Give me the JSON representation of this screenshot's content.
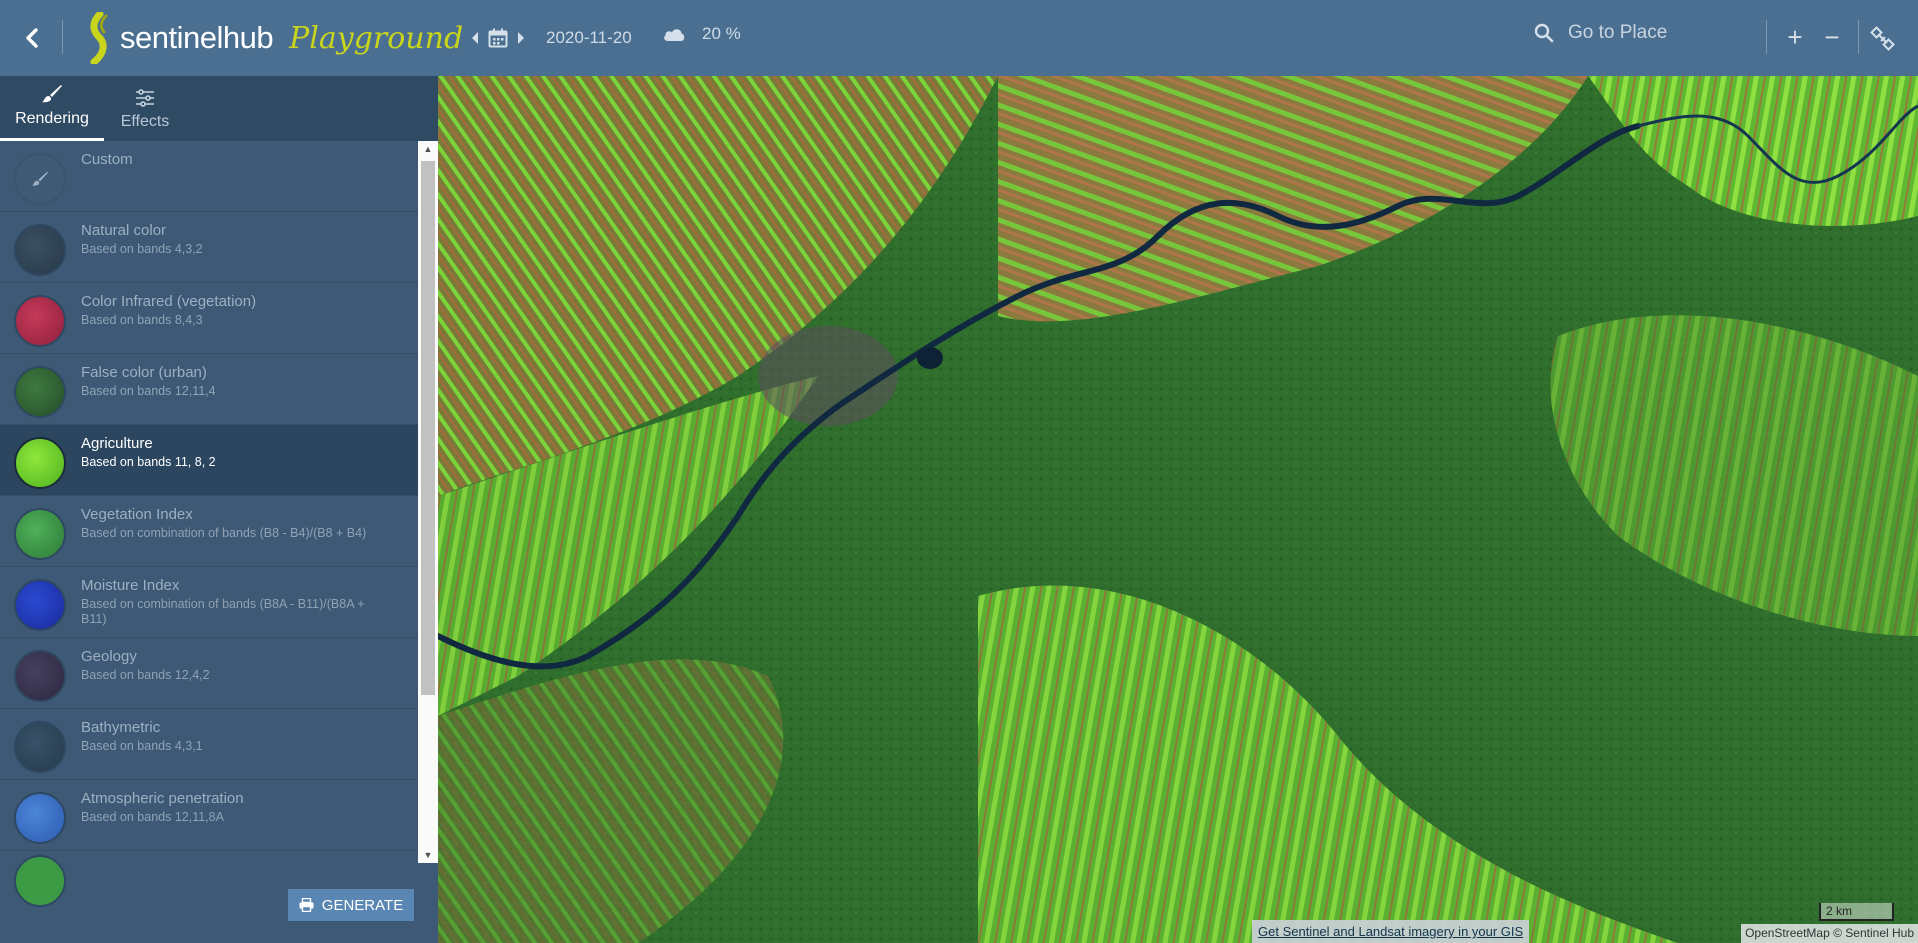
{
  "app": {
    "brand": "sentinelhub",
    "product": "Playground"
  },
  "header": {
    "date": "2020-11-20",
    "cloud_coverage": "20 %",
    "search_placeholder": "Go to Place",
    "zoom_in": "+",
    "zoom_out": "−"
  },
  "sidebar": {
    "tabs": [
      {
        "label": "Rendering",
        "icon": "brush-icon",
        "active": true
      },
      {
        "label": "Effects",
        "icon": "sliders-icon",
        "active": false
      }
    ],
    "items": [
      {
        "title": "Custom",
        "desc": "",
        "thumb_color": "#3f5a74",
        "active": false
      },
      {
        "title": "Natural color",
        "desc": "Based on bands 4,3,2",
        "thumb_color": "#2f4352",
        "active": false
      },
      {
        "title": "Color Infrared (vegetation)",
        "desc": "Based on bands 8,4,3",
        "thumb_color": "#b02848",
        "active": false
      },
      {
        "title": "False color (urban)",
        "desc": "Based on bands 12,11,4",
        "thumb_color": "#2f6135",
        "active": false
      },
      {
        "title": "Agriculture",
        "desc": "Based on bands 11, 8, 2",
        "thumb_color": "#6fd32a",
        "active": true
      },
      {
        "title": "Vegetation Index",
        "desc": "Based on combination of bands (B8 - B4)/(B8 + B4)",
        "thumb_color": "#3c9a45",
        "active": false
      },
      {
        "title": "Moisture Index",
        "desc": "Based on combination of bands (B8A - B11)/(B8A + B11)",
        "thumb_color": "#1e37b8",
        "active": false
      },
      {
        "title": "Geology",
        "desc": "Based on bands 12,4,2",
        "thumb_color": "#3a3450",
        "active": false
      },
      {
        "title": "Bathymetric",
        "desc": "Based on bands 4,3,1",
        "thumb_color": "#2f4458",
        "active": false
      },
      {
        "title": "Atmospheric penetration",
        "desc": "Based on bands 12,11,8A",
        "thumb_color": "#3a72c8",
        "active": false
      }
    ],
    "generate_label": "GENERATE"
  },
  "map": {
    "attribution_link": "Get Sentinel and Landsat imagery in your GIS",
    "attribution": "OpenStreetMap  © Sentinel Hub",
    "scale_label": "2 km"
  },
  "colors": {
    "header_bg": "#4a6f91",
    "sidebar_bg": "#3d5975",
    "accent_logo": "#c8d51c",
    "button_bg": "#5a86b3"
  }
}
